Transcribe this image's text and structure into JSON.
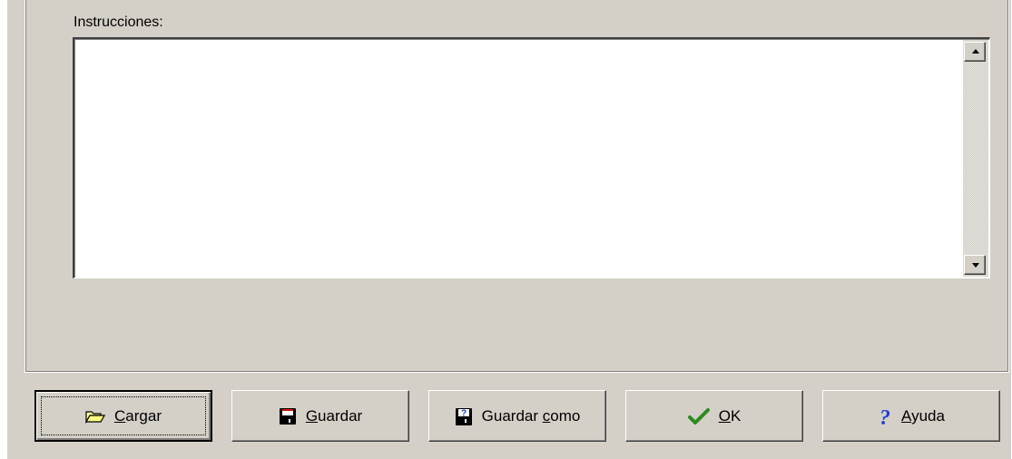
{
  "instructions": {
    "label": "Instrucciones:",
    "value": ""
  },
  "scrollbar": {
    "up_icon": "scroll-up-arrow",
    "down_icon": "scroll-down-arrow"
  },
  "buttons": {
    "cargar": {
      "pre": "",
      "accel": "C",
      "post": "argar",
      "icon": "open-folder-icon"
    },
    "guardar": {
      "pre": "",
      "accel": "G",
      "post": "uardar",
      "icon": "floppy-disk-icon"
    },
    "guardar_como": {
      "pre": "Guardar ",
      "accel": "c",
      "post": "omo",
      "icon": "floppy-save-as-icon"
    },
    "ok": {
      "pre": "",
      "accel": "O",
      "post": "K",
      "icon": "checkmark-icon"
    },
    "ayuda": {
      "pre": "",
      "accel": "A",
      "post": "yuda",
      "icon": "help-icon"
    }
  },
  "colors": {
    "face": "#d4d0c8",
    "accent_green": "#2e8b1e",
    "accent_blue": "#1f3fd0"
  }
}
